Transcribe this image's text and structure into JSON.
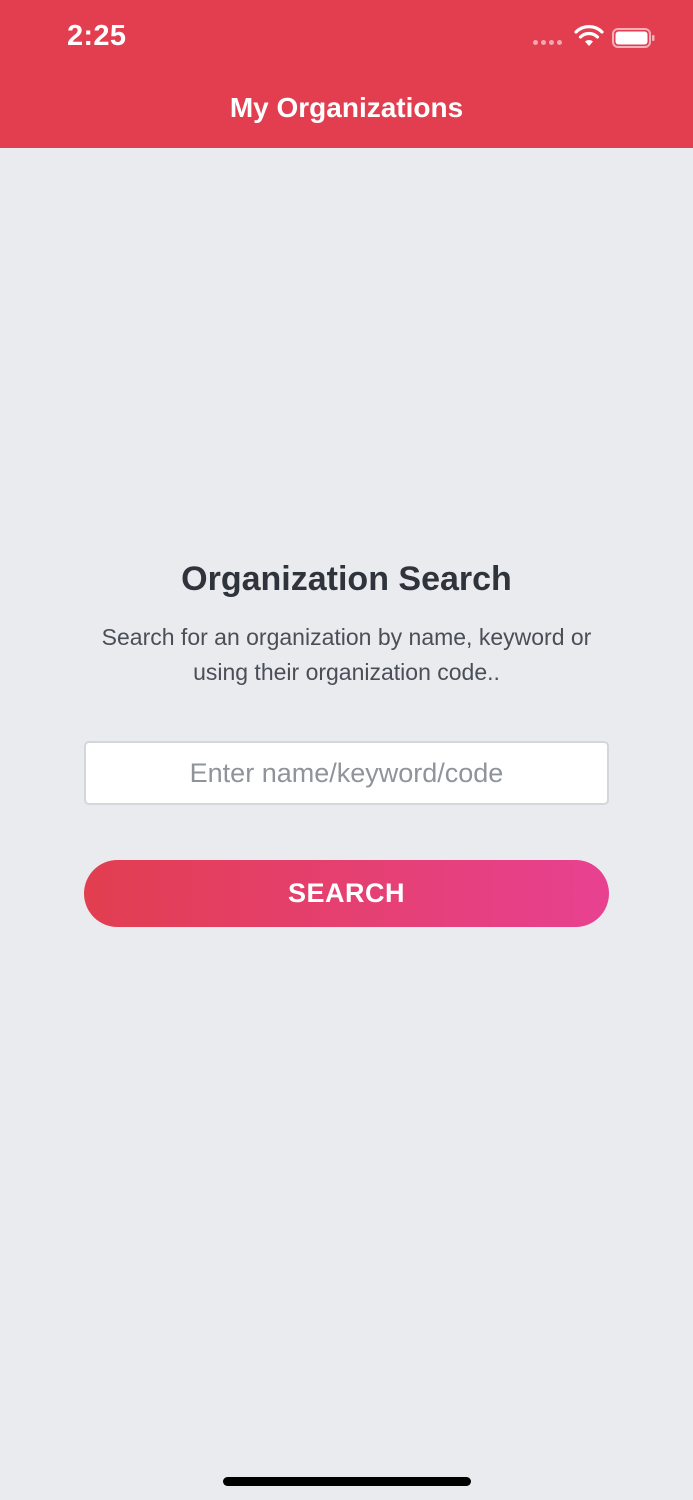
{
  "status_bar": {
    "time": "2:25"
  },
  "nav": {
    "title": "My Organizations"
  },
  "main": {
    "heading": "Organization Search",
    "description": "Search for an organization by name, keyword or using their organization code..",
    "search_placeholder": "Enter name/keyword/code",
    "search_value": "",
    "search_button_label": "SEARCH"
  },
  "colors": {
    "header_bg": "#e23e50",
    "page_bg": "#eaebef",
    "button_gradient_start": "#e23e50",
    "button_gradient_end": "#e84191"
  },
  "icons": {
    "signal": "signal-dots-icon",
    "wifi": "wifi-icon",
    "battery": "battery-icon"
  }
}
